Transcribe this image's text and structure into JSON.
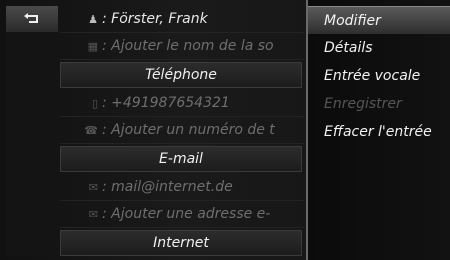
{
  "list": {
    "name_row": "Förster, Frank",
    "add_name": "Ajouter le nom de la so",
    "phone_header": "Téléphone",
    "phone_number": "+491987654321",
    "add_phone": "Ajouter un numéro de t",
    "email_header": "E-mail",
    "email": "mail@internet.de",
    "add_email": "Ajouter une adresse e-",
    "internet_header": "Internet"
  },
  "menu": {
    "items": [
      "Modifier",
      "Détails",
      "Entrée vocale",
      "Enregistrer",
      "Effacer l'entrée"
    ]
  }
}
